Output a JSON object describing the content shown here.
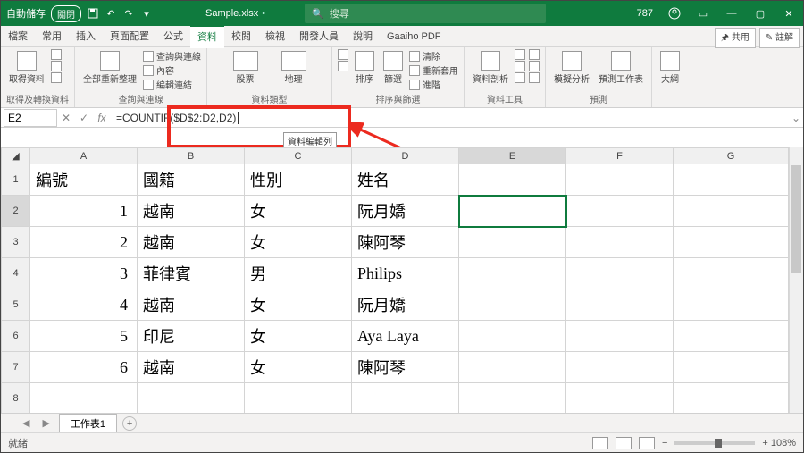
{
  "title": {
    "autosave": "自動儲存",
    "autosave_state": "關閉",
    "docname": "Sample.xlsx",
    "search_placeholder": "搜尋",
    "user_count": "787"
  },
  "tabs": [
    "檔案",
    "常用",
    "插入",
    "頁面配置",
    "公式",
    "資料",
    "校閱",
    "檢視",
    "開發人員",
    "說明",
    "Gaaiho PDF"
  ],
  "tabs_active_index": 5,
  "ribbon_right": {
    "share": "共用",
    "comment": "註解"
  },
  "ribbon": {
    "grp1": {
      "btn": "取得資料",
      "lbl": "取得及轉換資料"
    },
    "grp2": {
      "btn": "全部重新整理",
      "l1": "查詢與連線",
      "l2": "內容",
      "l3": "編輯連結",
      "lbl": "查詢與連線"
    },
    "grp3": {
      "b1": "股票",
      "b2": "地理",
      "lbl": "資料類型"
    },
    "grp4": {
      "b1": "排序",
      "b2": "篩選",
      "l1": "清除",
      "l2": "重新套用",
      "l3": "進階",
      "lbl": "排序與篩選"
    },
    "grp5": {
      "b1": "資料剖析",
      "lbl": "資料工具"
    },
    "grp6": {
      "b1": "模擬分析",
      "b2": "預測工作表",
      "lbl": "預測"
    },
    "grp7": {
      "b1": "大綱"
    }
  },
  "fx": {
    "namebox": "E2",
    "formula": "=COUNTIF($D$2:D2,D2)",
    "tooltip": "資料編輯列"
  },
  "cols": [
    "A",
    "B",
    "C",
    "D",
    "E",
    "F",
    "G"
  ],
  "rows": [
    {
      "n": "1",
      "A": "編號",
      "B": "國籍",
      "C": "性別",
      "D": "姓名",
      "E": "",
      "F": "",
      "G": ""
    },
    {
      "n": "2",
      "A": "1",
      "B": "越南",
      "C": "女",
      "D": "阮月嬌",
      "E": "",
      "F": "",
      "G": ""
    },
    {
      "n": "3",
      "A": "2",
      "B": "越南",
      "C": "女",
      "D": "陳阿琴",
      "E": "",
      "F": "",
      "G": ""
    },
    {
      "n": "4",
      "A": "3",
      "B": "菲律賓",
      "C": "男",
      "D": "Philips",
      "E": "",
      "F": "",
      "G": ""
    },
    {
      "n": "5",
      "A": "4",
      "B": "越南",
      "C": "女",
      "D": "阮月嬌",
      "E": "",
      "F": "",
      "G": ""
    },
    {
      "n": "6",
      "A": "5",
      "B": "印尼",
      "C": "女",
      "D": "Aya Laya",
      "E": "",
      "F": "",
      "G": ""
    },
    {
      "n": "7",
      "A": "6",
      "B": "越南",
      "C": "女",
      "D": "陳阿琴",
      "E": "",
      "F": "",
      "G": ""
    },
    {
      "n": "8",
      "A": "",
      "B": "",
      "C": "",
      "D": "",
      "E": "",
      "F": "",
      "G": ""
    }
  ],
  "sel": {
    "row": "2",
    "col": "E"
  },
  "sheet": {
    "name": "工作表1"
  },
  "status": {
    "left": "就緒",
    "zoom": "+ 108%"
  }
}
